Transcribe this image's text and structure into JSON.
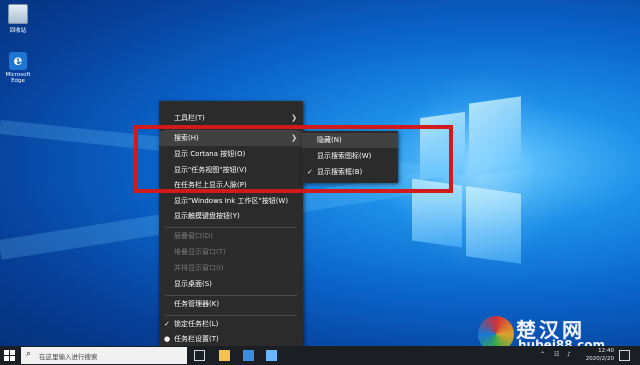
{
  "desktop": {
    "icons": [
      {
        "label": "回收站",
        "icon": "recycle-bin-icon"
      },
      {
        "label": "Microsoft Edge",
        "icon": "edge-icon",
        "glyph": "e"
      }
    ]
  },
  "context_menu": {
    "items": [
      {
        "label": "工具栏(T)",
        "has_submenu": true
      },
      {
        "label": "搜索(H)",
        "has_submenu": true,
        "active": true
      },
      {
        "label": "显示 Cortana 按钮(O)"
      },
      {
        "label": "显示\"任务视图\"按钮(V)"
      },
      {
        "label": "在任务栏上显示人脉(P)"
      },
      {
        "label": "显示\"Windows Ink 工作区\"按钮(W)"
      },
      {
        "label": "显示触摸键盘按钮(Y)"
      },
      {
        "label": "层叠窗口(D)",
        "disabled": true
      },
      {
        "label": "堆叠显示窗口(T)",
        "disabled": true
      },
      {
        "label": "并排显示窗口(I)",
        "disabled": true
      },
      {
        "label": "显示桌面(S)"
      },
      {
        "label": "任务管理器(K)"
      },
      {
        "label": "锁定任务栏(L)",
        "check": "✓"
      },
      {
        "label": "任务栏设置(T)",
        "check": "●"
      }
    ]
  },
  "submenu": {
    "items": [
      {
        "label": "隐藏(N)"
      },
      {
        "label": "显示搜索图标(W)"
      },
      {
        "label": "显示搜索框(B)",
        "check": "✓"
      }
    ]
  },
  "taskbar": {
    "search_placeholder": "在这里输入进行搜索",
    "start_icon": "windows-start-icon",
    "clock_time": "12:40",
    "clock_date": "2020/2/20"
  },
  "watermark": {
    "line1": "楚汉网",
    "line2": "hubei88.com"
  }
}
